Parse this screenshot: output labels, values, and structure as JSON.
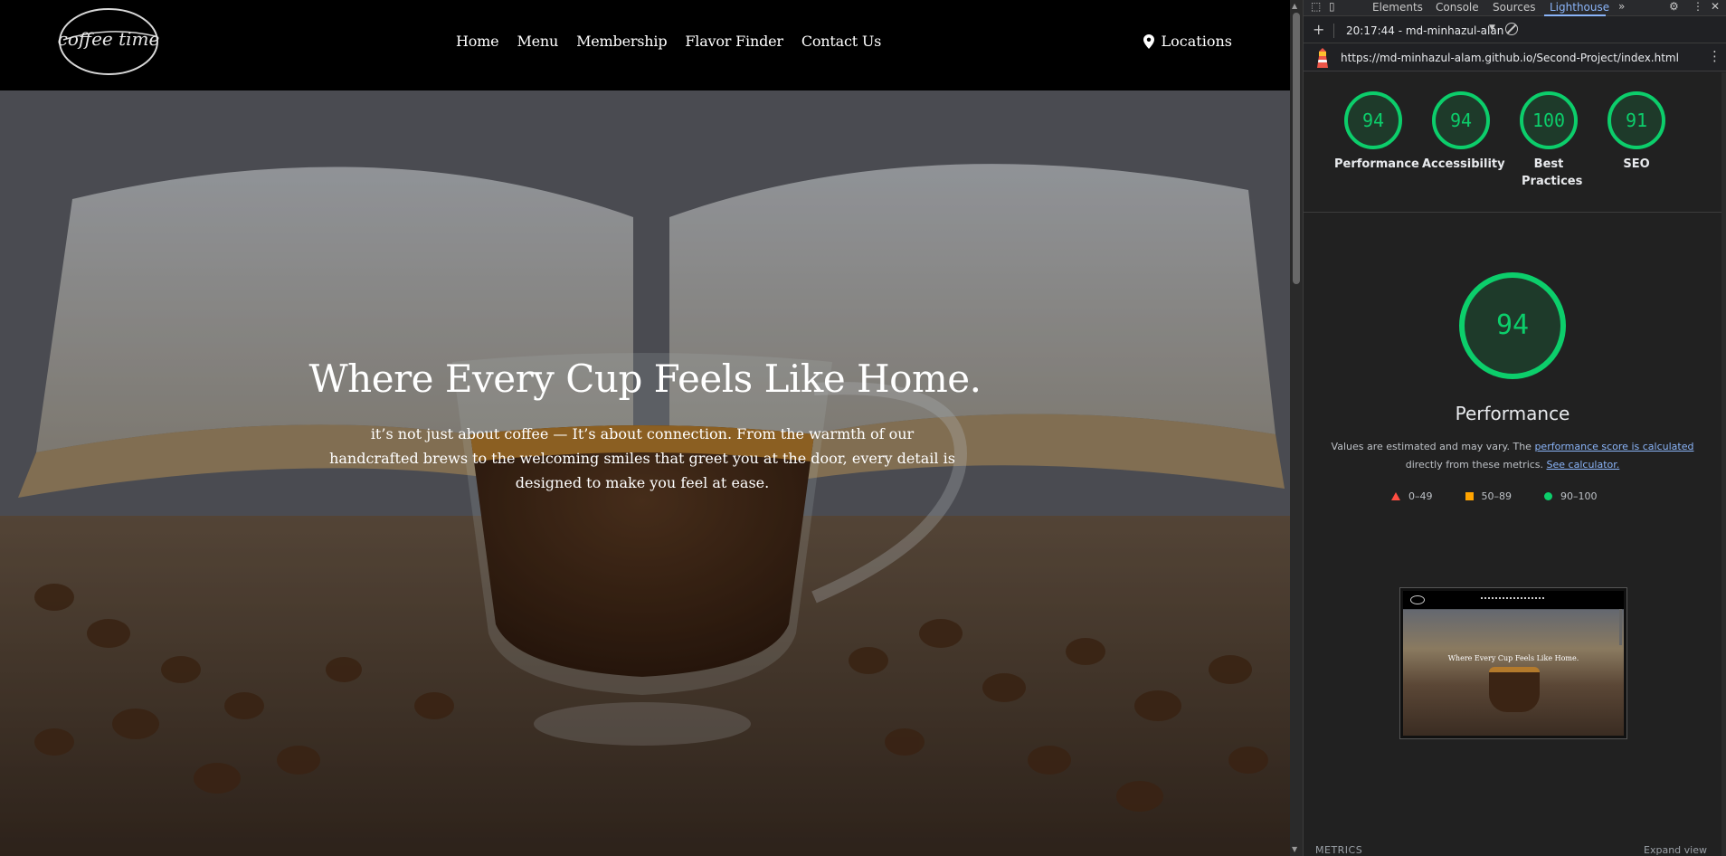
{
  "site": {
    "logo_text": "coffee time",
    "nav": [
      "Home",
      "Menu",
      "Membership",
      "Flavor Finder",
      "Contact Us"
    ],
    "locations_label": "Locations",
    "hero": {
      "title": "Where Every Cup Feels Like Home.",
      "subtitle": "it’s not just about coffee — It’s about connection. From the warmth of our handcrafted brews to the welcoming smiles that greet you at the door, every detail is designed to make you feel at ease."
    }
  },
  "devtools": {
    "tabs": [
      "Elements",
      "Console",
      "Sources",
      "Lighthouse"
    ],
    "active_tab": "Lighthouse",
    "report_label": "20:17:44 - md-minhazul-alan",
    "url": "https://md-minhazul-alam.github.io/Second-Project/index.html",
    "gauges": [
      {
        "score": "94",
        "label": "Performance"
      },
      {
        "score": "94",
        "label": "Accessibility"
      },
      {
        "score": "100",
        "label": "Best Practices"
      },
      {
        "score": "91",
        "label": "SEO"
      }
    ],
    "main_score": "94",
    "main_title": "Performance",
    "desc_before": "Values are estimated and may vary. The ",
    "desc_link1": "performance score is calculated",
    "desc_middle": " directly from these metrics. ",
    "desc_link2": "See calculator.",
    "legend": [
      {
        "range": "0–49",
        "color": "#ff4e42"
      },
      {
        "range": "50–89",
        "color": "#ffa400"
      },
      {
        "range": "90–100",
        "color": "#0cce6b"
      }
    ],
    "thumbnail_title": "Where Every Cup Feels Like Home.",
    "metrics_label": "METRICS",
    "expand_label": "Expand view",
    "colors": {
      "pass": "#0cce6b",
      "link": "#8ab4f8",
      "panel": "#202124"
    }
  }
}
